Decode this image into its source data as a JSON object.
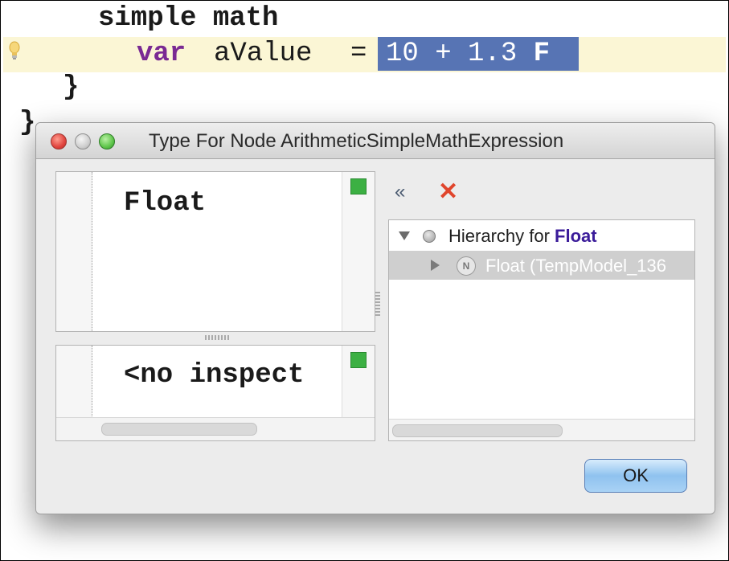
{
  "editor": {
    "line1": "simple math",
    "keyword_var": "var",
    "identifier": "aValue",
    "operator": "=",
    "selected_expr_prefix": "10 + 1.3 ",
    "selected_expr_suffix": "F",
    "close_brace_inner": "}",
    "close_brace_outer": "}"
  },
  "dialog": {
    "title": "Type For Node ArithmeticSimpleMathExpression",
    "type_panel_text": "Float",
    "inspector_panel_text": "<no inspect",
    "toolbar": {
      "collapse_glyph": "«",
      "close_glyph": "✕"
    },
    "hierarchy": {
      "root_prefix": "Hierarchy for ",
      "root_type": "Float",
      "child_badge": "N",
      "child_label": "Float (TempModel_136"
    },
    "ok_label": "OK"
  }
}
